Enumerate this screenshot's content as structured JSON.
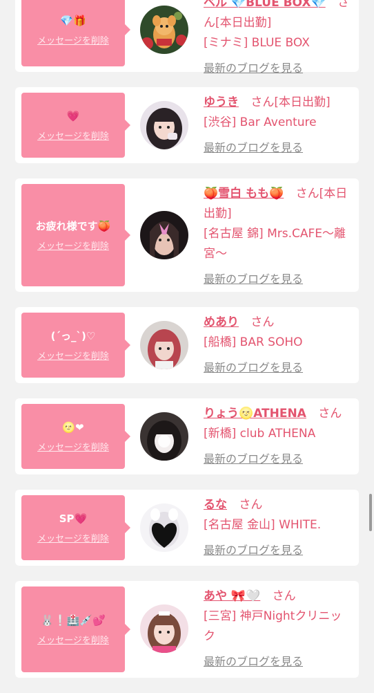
{
  "delete_label": "メッセージを削除",
  "blog_label": "最新のブログを見る",
  "san": "さん",
  "colors": {
    "accent_pink": "#f98ea6",
    "text_pink": "#e3546f",
    "gray": "#8a8a8a"
  },
  "cards": [
    {
      "message": "💎🎁",
      "name": "ベル 💎BLUE BOX💎",
      "status": "[本日出勤]",
      "shop": "[ミナミ] BLUE BOX"
    },
    {
      "message": "💗",
      "name": "ゆうき",
      "status": "[本日出勤]",
      "shop": "[渋谷] Bar Aventure"
    },
    {
      "message": "お疲れ様です🍑",
      "name": "🍑雪白 もも🍑",
      "status": "[本日出勤]",
      "shop": "[名古屋 錦] Mrs.CAFE〜離宮〜"
    },
    {
      "message": "(ˊっ_ˋ)♡",
      "name": "めあり",
      "status": "",
      "shop": "[船橋] BAR SOHO"
    },
    {
      "message": "🌝❤",
      "name": "りょう🌝ATHENA",
      "status": "",
      "shop": "[新橋] club ATHENA"
    },
    {
      "message": "SP💗",
      "name": "るな",
      "status": "",
      "shop": "[名古屋 金山] WHITE."
    },
    {
      "message": "🐰❕🏥💉💕",
      "name": "あや 🎀🤍",
      "status": "",
      "shop": "[三宮] 神戸Nightクリニック"
    }
  ]
}
